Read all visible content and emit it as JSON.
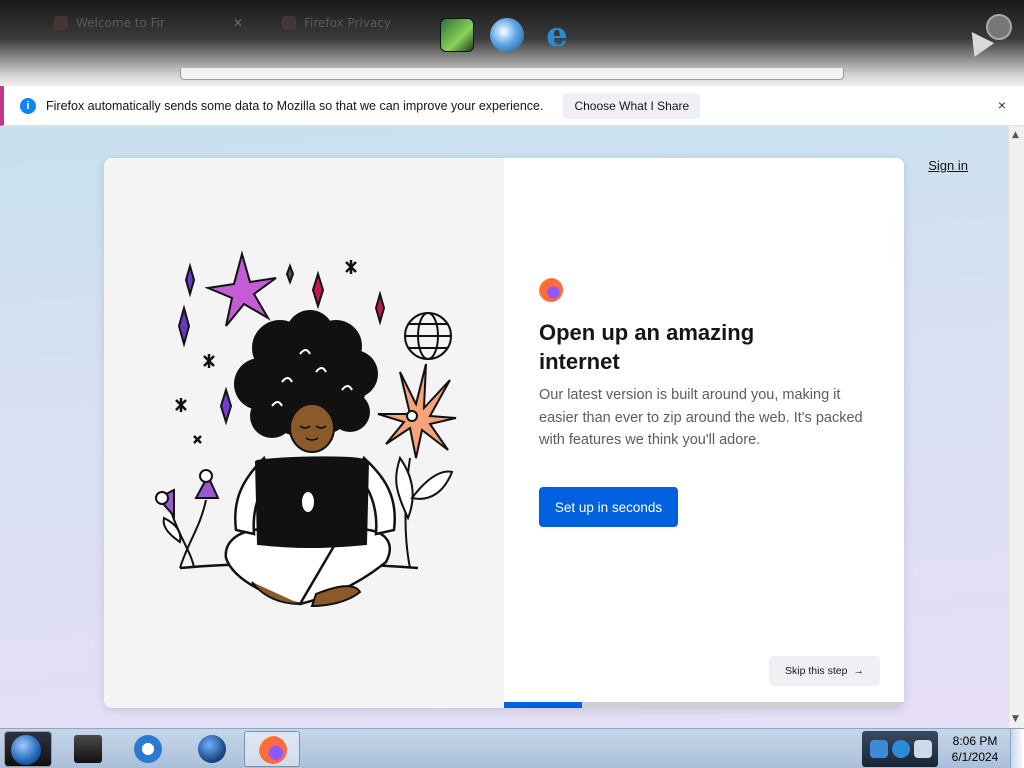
{
  "browser": {
    "tabs": [
      {
        "title": "Welcome to Fir"
      },
      {
        "title": "Firefox Privacy"
      }
    ]
  },
  "notification": {
    "message": "Firefox automatically sends some data to Mozilla so that we can improve your experience.",
    "button_label": "Choose What I Share",
    "close_symbol": "×"
  },
  "page": {
    "sign_in": "Sign in",
    "headline": "Open up an amazing internet",
    "body": "Our latest version is built around you, making it easier than ever to zip around the web. It's packed with features we think you'll adore.",
    "cta_label": "Set up in seconds",
    "skip_label": "Skip this step",
    "skip_arrow": "→",
    "progress": 0.195
  },
  "taskbar": {
    "time": "8:06 PM",
    "date": "6/1/2024"
  },
  "colors": {
    "accent": "#0061e0",
    "notification_stripe": "#c1368a",
    "info": "#0a84ff"
  }
}
